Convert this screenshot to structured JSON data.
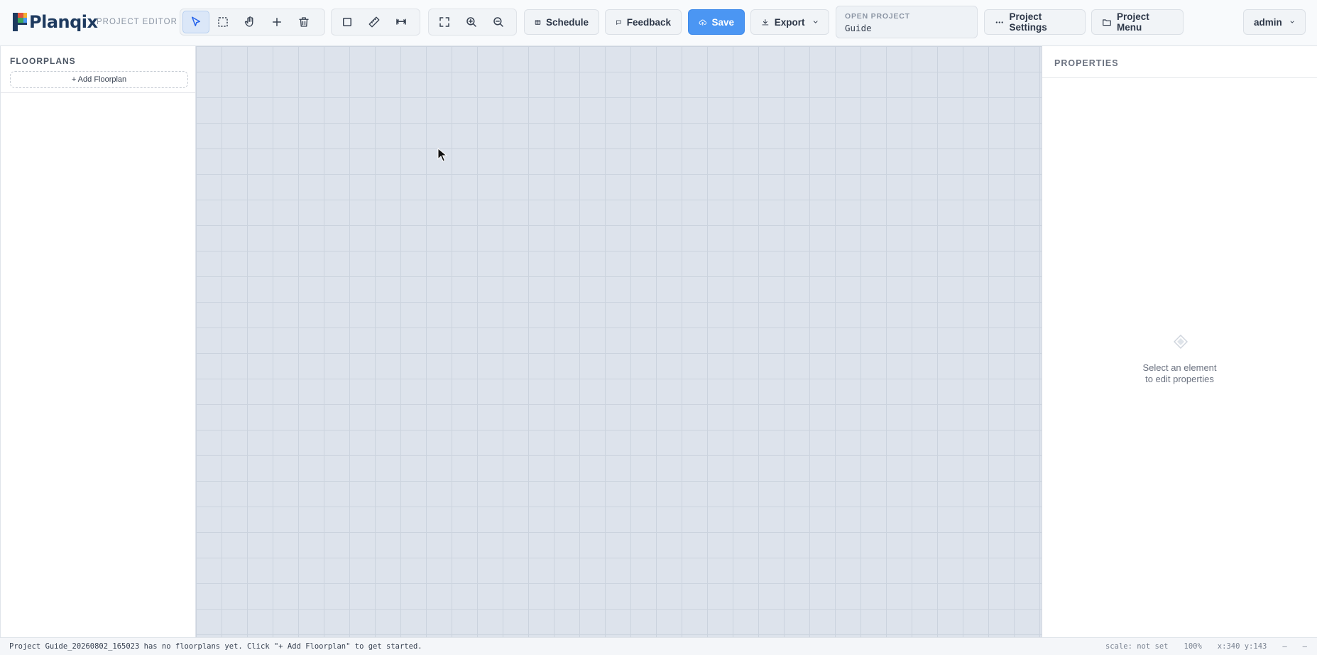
{
  "app": {
    "name": "Planqix",
    "mode_label": "PROJECT EDITOR"
  },
  "toolbar": {
    "tools": [
      {
        "name": "select",
        "icon": "pointer-icon",
        "active": true
      },
      {
        "name": "marquee",
        "icon": "marquee-select-icon"
      },
      {
        "name": "pan",
        "icon": "hand-icon"
      },
      {
        "name": "add",
        "icon": "plus-icon"
      },
      {
        "name": "delete",
        "icon": "trash-icon"
      },
      {
        "name": "rectangle",
        "icon": "square-icon"
      },
      {
        "name": "measure",
        "icon": "ruler-icon"
      },
      {
        "name": "dimension",
        "icon": "dimension-icon"
      },
      {
        "name": "fit",
        "icon": "fit-screen-icon"
      },
      {
        "name": "zoom-in",
        "icon": "zoom-in-icon"
      },
      {
        "name": "zoom-out",
        "icon": "zoom-out-icon"
      }
    ],
    "schedule_label": "Schedule",
    "feedback_label": "Feedback",
    "save_label": "Save",
    "export_label": "Export",
    "open_project": {
      "label": "OPEN PROJECT",
      "value": "Guide"
    },
    "project_settings_label": "Project Settings",
    "project_menu_label": "Project Menu",
    "user_label": "admin"
  },
  "sidebar": {
    "title": "FLOORPLANS",
    "add_label": "+ Add Floorplan"
  },
  "properties": {
    "title": "PROPERTIES",
    "empty_line1": "Select an element",
    "empty_line2": "to edit properties"
  },
  "status": {
    "message": "Project Guide_20260802_165023 has no floorplans yet. Click \"+ Add Floorplan\" to get started.",
    "scale": "scale: not set",
    "zoom": "100%",
    "coords": "x:340 y:143",
    "extra1": "–",
    "extra2": "–"
  },
  "colors": {
    "accent": "#4b96f3",
    "canvas": "#dde3ec",
    "grid": "#cbd3de"
  }
}
